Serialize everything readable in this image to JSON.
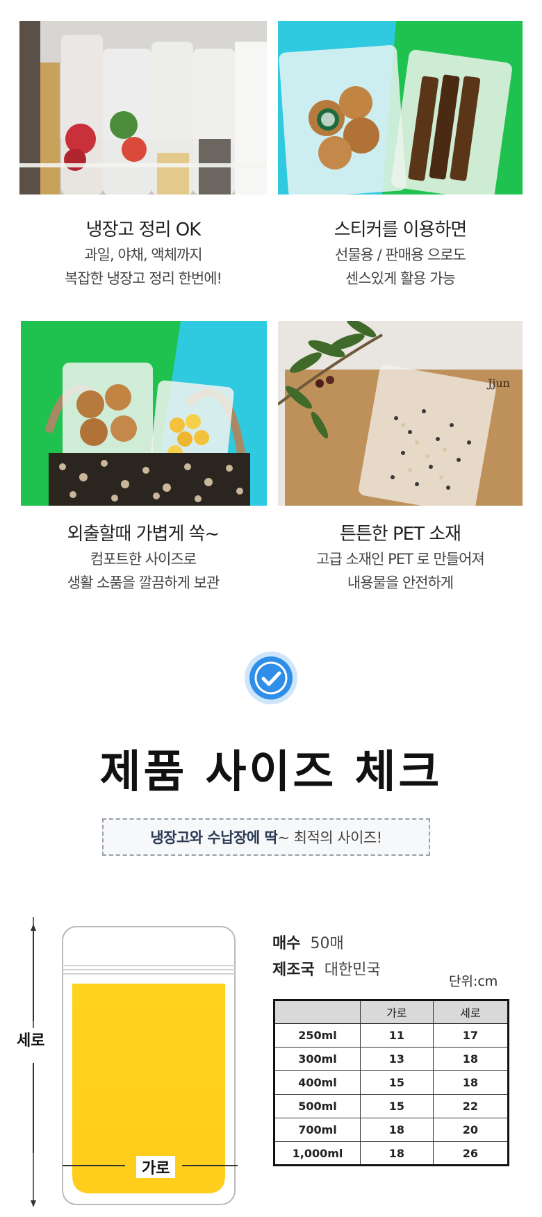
{
  "features": [
    {
      "title": "냉장고 정리 OK",
      "desc1": "과일, 야채, 액체까지",
      "desc2": "복잡한 냉장고 정리 한번에!"
    },
    {
      "title": "스티커를 이용하면",
      "desc1": "선물용 / 판매용 으로도",
      "desc2": "센스있게 활용 가능"
    },
    {
      "title": "외출할때 가볍게 쏙~",
      "desc1": "컴포트한 사이즈로",
      "desc2": "생활 소품을 깔끔하게 보관"
    },
    {
      "title": "튼튼한 PET 소재",
      "desc1": "고급 소재인 PET 로 만들어져",
      "desc2": "내용물을 안전하게"
    }
  ],
  "photos": {
    "fridge": "fridge-storage-photo",
    "gift": "gift-sticker-photo",
    "bag": "outing-bag-photo",
    "grain": "pet-grain-photo"
  },
  "photo_text": {
    "brand": "Jjun"
  },
  "section": {
    "title": "제품 사이즈 체크",
    "subtitle_strong": "냉장고와 수납장에 딱",
    "subtitle_rest": "~ 최적의 사이즈!"
  },
  "diagram": {
    "height_label": "세로",
    "width_label": "가로"
  },
  "specs": {
    "count_label": "매수",
    "count_value": "50매",
    "origin_label": "제조국",
    "origin_value": "대한민국",
    "unit": "단위:cm"
  },
  "size_table": {
    "headers": [
      "",
      "가로",
      "세로"
    ],
    "rows": [
      [
        "250ml",
        "11",
        "17"
      ],
      [
        "300ml",
        "13",
        "18"
      ],
      [
        "400ml",
        "15",
        "18"
      ],
      [
        "500ml",
        "15",
        "22"
      ],
      [
        "700ml",
        "18",
        "20"
      ],
      [
        "1,000ml",
        "18",
        "26"
      ]
    ]
  },
  "colors": {
    "accent_blue": "#2f8ee8",
    "pouch_yellow": "#ffd21f",
    "green_bg": "#1fc14f",
    "cyan_bg": "#2fc9e0"
  }
}
